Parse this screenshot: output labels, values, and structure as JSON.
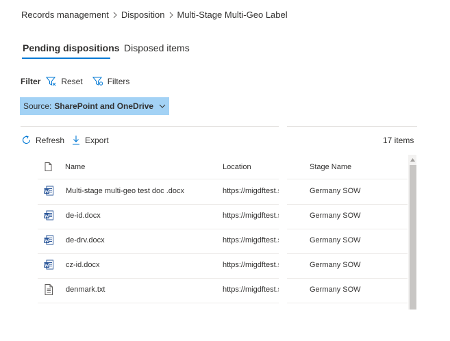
{
  "breadcrumb": {
    "items": [
      "Records management",
      "Disposition",
      "Multi-Stage Multi-Geo Label"
    ]
  },
  "tabs": [
    {
      "label": "Pending dispositions",
      "active": true
    },
    {
      "label": "Disposed items",
      "active": false
    }
  ],
  "filter": {
    "label": "Filter",
    "reset_label": "Reset",
    "filters_label": "Filters"
  },
  "source": {
    "label": "Source:",
    "value": "SharePoint and OneDrive"
  },
  "commands": {
    "refresh_label": "Refresh",
    "export_label": "Export",
    "items_count": "17 items"
  },
  "table": {
    "columns": {
      "file_type_icon": "document-icon",
      "name": "Name",
      "location": "Location",
      "stage_name": "Stage Name"
    },
    "rows": [
      {
        "icon": "word-document-icon",
        "name": "Multi-stage multi-geo test doc .docx",
        "location": "https://migdftest.s",
        "stage": "Germany SOW"
      },
      {
        "icon": "word-document-icon",
        "name": "de-id.docx",
        "location": "https://migdftest.s",
        "stage": "Germany SOW"
      },
      {
        "icon": "word-document-icon",
        "name": "de-drv.docx",
        "location": "https://migdftest.s",
        "stage": "Germany SOW"
      },
      {
        "icon": "word-document-icon",
        "name": "cz-id.docx",
        "location": "https://migdftest.s",
        "stage": "Germany SOW"
      },
      {
        "icon": "text-file-icon",
        "name": "denmark.txt",
        "location": "https://migdftest.s",
        "stage": "Germany SOW"
      }
    ]
  },
  "colors": {
    "accent": "#0078d4",
    "source_chip_bg": "#a3d2f5",
    "word_blue": "#2b579a"
  }
}
